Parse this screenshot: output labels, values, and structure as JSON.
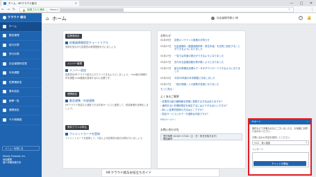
{
  "browser": {
    "tab_title": "ホーム - MFクラウド給与",
    "secure_label": "保護された通信",
    "url_prefix": "https://",
    "min_icon": "—",
    "max_icon": "□",
    "close_icon": "✕",
    "tab_close": "×"
  },
  "sidebar": {
    "brand": "クラウド 給与",
    "items": [
      {
        "label": "ホーム",
        "icon": "home-icon",
        "active": true
      },
      {
        "label": "勤怠管理",
        "icon": "clock-icon"
      },
      {
        "label": "給与計算",
        "icon": "yen-icon"
      },
      {
        "label": "賞与計算",
        "icon": "gift-icon"
      },
      {
        "label": "社会保険料変更",
        "icon": "shield-icon"
      },
      {
        "label": "年末調整",
        "icon": "calendar-icon"
      },
      {
        "label": "従業員設定",
        "icon": "people-icon"
      },
      {
        "label": "基本設定",
        "icon": "gear-icon"
      },
      {
        "label": "帳票一覧",
        "icon": "document-icon"
      },
      {
        "label": "連携設定",
        "icon": "link-icon"
      },
      {
        "label": "その他機能",
        "icon": "grid-icon"
      }
    ],
    "menu_toggle": "メニューを閉じる",
    "company_line1": "Money Forward, Inc.",
    "company_line2": "利用履歴",
    "company_line3": "個人情報保護方針"
  },
  "header": {
    "title": "ホーム",
    "user": "社会保険労務士 様",
    "help": "?"
  },
  "left_sections": [
    {
      "tag": "従業員設定",
      "link": "従業員情報設定チュートリアル",
      "desc": "説明を見ながら従業員の新規登録を行いましょう。"
    },
    {
      "tag": "メンバー管理",
      "link": "メンバー追加",
      "desc": "従業員をMFクラウド給与にログインできるようにしましょう。 mail給与明細や年末調整 mail機能を使用するのに必要です。"
    },
    {
      "tag": "連携設定",
      "link": "勤怠連携・外部連携",
      "desc": "MFクラウド勤怠など連携できる外部サービスと連携して、勤怠管理を効率化しましょう。"
    },
    {
      "tag": "有料プランの申込",
      "link": "クレジットカードを登録",
      "desc": "クレジットカードを登録して、2名以上の従業員の給与計算を行いましょう。"
    }
  ],
  "news": {
    "heading": "お知らせ",
    "items": [
      {
        "date": "04月09日",
        "text": "定期メンテナンス実施のお知らせ"
      },
      {
        "date": "03月27日",
        "text": "社会保険料（健康保険料率・厚生年金）を目的に設定することができるようになりました"
      },
      {
        "date": "03月27日",
        "text": "一覧では年度の表示ができるようになりました"
      },
      {
        "date": "03月27日",
        "text": "賞与手当金額自動計算が動くようになりました"
      },
      {
        "date": "03月27日",
        "text": "給与計算確定処理のデータがダウンロードできるようになりました"
      },
      {
        "date": "03月22日",
        "text": "平成30年度の年末調整に対応しました"
      },
      {
        "date": "03月27日",
        "text": "「給与明細」との連携が容易になりました"
      }
    ],
    "more": "もっと見る ›"
  },
  "faq": {
    "heading": "よくあるご質問",
    "items": [
      "› 従業員の給与額情報を簡単に登録する方法はありますか？",
      "› 通勤手当と非課税規定を設定するにはどうすればいいですか？",
      "› 新しい従業員登録の方法はどこですか？",
      "› 勤怠サービスとのデータ連携は可能ですか？"
    ],
    "more": "FAQページへ ›"
  },
  "contact": {
    "heading": "お問い合わせ先",
    "hours": "受付時間 10:00〜17:00（土・日・祝日を除きます）",
    "phone": "電話番号"
  },
  "footer_banner": "MFクラウド給与お役立ちガイド",
  "chat": {
    "title": "サポート",
    "minimize": "⌃",
    "message": "操作などで不明な点などございましたら、お気軽にお問い合わせください。",
    "category_label": "お問い合わせ内容を選択してください",
    "category_value": "5-01　導入相談",
    "message_label": "メッセージ",
    "submit": "チャットを開始"
  }
}
